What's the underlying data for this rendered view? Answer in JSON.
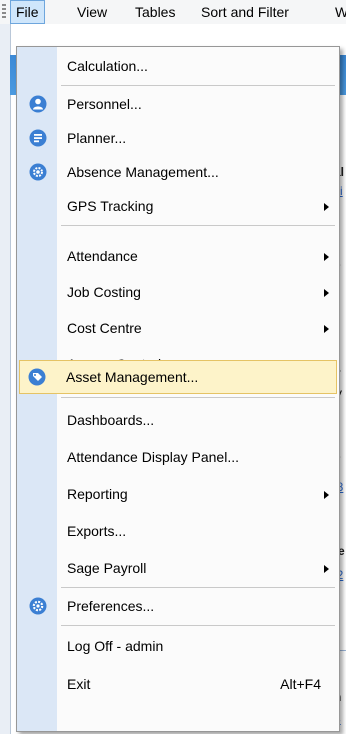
{
  "menubar": {
    "items": [
      {
        "label": "File",
        "active": true
      },
      {
        "label": "View"
      },
      {
        "label": "Tables"
      },
      {
        "label": "Sort and Filter"
      },
      {
        "label": "W"
      }
    ]
  },
  "background_peek": {
    "texts": [
      "al",
      "ci",
      "s",
      "ti",
      "ti",
      "y",
      "V",
      "s",
      "i8",
      "te",
      "i2",
      "t",
      "n",
      "8"
    ]
  },
  "file_menu": {
    "items": [
      {
        "label": "Calculation...",
        "icon": null
      },
      {
        "label": "Personnel...",
        "icon": "person-icon"
      },
      {
        "label": "Planner...",
        "icon": "planner-icon"
      },
      {
        "label": "Absence Management...",
        "icon": "absence-gear-icon"
      },
      {
        "label": "GPS Tracking",
        "submenu": true
      },
      {
        "label": "Attendance",
        "submenu": true
      },
      {
        "label": "Job Costing",
        "submenu": true
      },
      {
        "label": "Cost Centre",
        "submenu": true
      },
      {
        "label": "Access Control",
        "submenu": true
      },
      {
        "label": "Asset Management...",
        "icon": "asset-tag-icon",
        "highlighted": true
      },
      {
        "label": "Dashboards..."
      },
      {
        "label": "Attendance Display Panel..."
      },
      {
        "label": "Reporting",
        "submenu": true
      },
      {
        "label": "Exports..."
      },
      {
        "label": "Sage Payroll",
        "submenu": true
      },
      {
        "label": "Preferences...",
        "icon": "preferences-gear-icon"
      },
      {
        "label": "Log Off - admin"
      },
      {
        "label": "Exit",
        "shortcut": "Alt+F4"
      }
    ]
  },
  "colors": {
    "highlight_bg": "#fdf3c9",
    "highlight_border": "#e5c365",
    "gutter": "#dbe7f6",
    "icon_blue": "#3b7fd3"
  }
}
